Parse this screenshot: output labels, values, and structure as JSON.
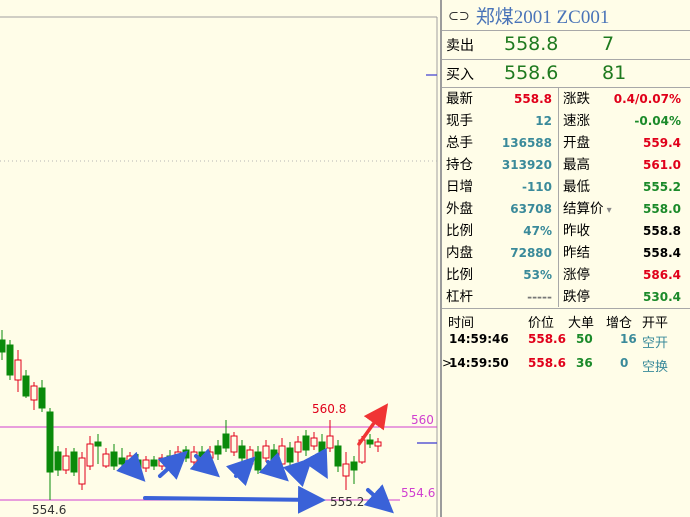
{
  "chart": {
    "level_upper": "560",
    "level_lower": "554.6",
    "high_label": "560.8",
    "low_label_left": "554.6",
    "low_label_mid": "555.2"
  },
  "quote": {
    "title": "郑煤2001  ZC001",
    "sell_label": "卖出",
    "sell_price": "558.8",
    "sell_vol": "7",
    "buy_label": "买入",
    "buy_price": "558.6",
    "buy_vol": "81"
  },
  "stats_left": [
    {
      "label": "最新",
      "value": "558.8",
      "color": "red"
    },
    {
      "label": "现手",
      "value": "12",
      "color": "teal"
    },
    {
      "label": "总手",
      "value": "136588",
      "color": "teal"
    },
    {
      "label": "持仓",
      "value": "313920",
      "color": "teal"
    },
    {
      "label": "日增",
      "value": "-110",
      "color": "teal"
    },
    {
      "label": "外盘",
      "value": "63708",
      "color": "teal"
    },
    {
      "label": "比例",
      "value": "47%",
      "color": "teal"
    },
    {
      "label": "内盘",
      "value": "72880",
      "color": "teal"
    },
    {
      "label": "比例",
      "value": "53%",
      "color": "teal"
    },
    {
      "label": "杠杆",
      "value": "-----",
      "color": "gray"
    }
  ],
  "stats_right": [
    {
      "label": "涨跌",
      "value": "0.4/0.07%",
      "color": "red"
    },
    {
      "label": "速涨",
      "value": "-0.04%",
      "color": "green"
    },
    {
      "label": "开盘",
      "value": "559.4",
      "color": "red"
    },
    {
      "label": "最高",
      "value": "561.0",
      "color": "red"
    },
    {
      "label": "最低",
      "value": "555.2",
      "color": "green"
    },
    {
      "label": "结算价",
      "value": "558.0",
      "color": "green"
    },
    {
      "label": "昨收",
      "value": "558.8",
      "color": "black"
    },
    {
      "label": "昨结",
      "value": "558.4",
      "color": "black"
    },
    {
      "label": "涨停",
      "value": "586.4",
      "color": "red"
    },
    {
      "label": "跌停",
      "value": "530.4",
      "color": "green"
    }
  ],
  "ticks": {
    "headers": [
      "时间",
      "价位",
      "大单",
      "增仓",
      "开平"
    ],
    "rows": [
      {
        "marker": "",
        "time": "14:59:46",
        "price": "558.6",
        "vol": "50",
        "chg": "16",
        "type": "空开"
      },
      {
        "marker": ">",
        "time": "14:59:50",
        "price": "558.6",
        "vol": "36",
        "chg": "0",
        "type": "空换"
      }
    ]
  },
  "colors": {
    "up": "#e0001a",
    "down": "#0a8a0a",
    "arrow_blue": "#3a62d8",
    "arrow_red": "#f03434",
    "level": "#d040d0"
  }
}
